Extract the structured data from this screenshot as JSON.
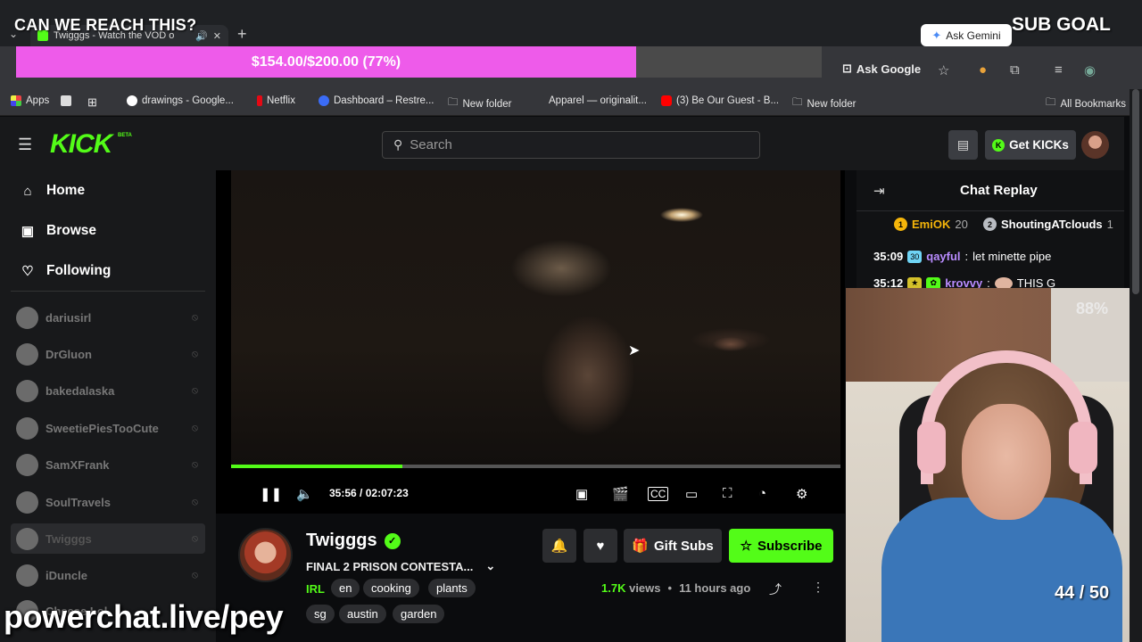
{
  "browser": {
    "tab_title": "Twigggs - Watch the VOD o",
    "new_tab": "+",
    "ask_gemini": "Ask Gemini",
    "ask_google": "Ask Google",
    "bookmarks": [
      {
        "label": "Apps",
        "color": "#e44"
      },
      {
        "label": "drawings - Google...",
        "color": "#fff"
      },
      {
        "label": "Netflix",
        "color": "#e50914"
      },
      {
        "label": "Dashboard – Restre...",
        "color": "#3b6cf6"
      },
      {
        "label": "New folder",
        "color": "#aaa"
      },
      {
        "label": "Apparel — originalit...",
        "color": "#35363a"
      },
      {
        "label": "(3) Be Our Guest - B...",
        "color": "#f00"
      },
      {
        "label": "New folder",
        "color": "#aaa"
      },
      {
        "label": "All Bookmarks",
        "color": "#aaa"
      }
    ]
  },
  "overlay": {
    "title": "CAN WE REACH THIS?",
    "goal_text": "$154.00/$200.00 (77%)",
    "goal_fraction": 0.77,
    "sub_goal_label": "SUB GOAL",
    "sub_count": "44 / 50",
    "webcam_pct": "88%",
    "powerchat": "powerchat.live/pey"
  },
  "kick": {
    "logo": "KICK",
    "logo_beta": "BETA",
    "search_placeholder": "Search",
    "get_kicks": "Get KICKs",
    "nav": [
      {
        "label": "Home",
        "icon": "home-icon"
      },
      {
        "label": "Browse",
        "icon": "browse-icon"
      },
      {
        "label": "Following",
        "icon": "heart-icon"
      }
    ],
    "channels": [
      "dariusirl",
      "DrGluon",
      "bakedalaska",
      "SweetiePiesTooCute",
      "SamXFrank",
      "SoulTravels",
      "Twigggs",
      "iDuncle",
      "Cheese Lol"
    ]
  },
  "player": {
    "time_current": "35:56",
    "time_total": "02:07:23",
    "progress_fraction": 0.281
  },
  "stream": {
    "channel": "Twigggs",
    "title": "FINAL 2 PRISON CONTESTA...",
    "category": "IRL",
    "tags": [
      "en",
      "cooking",
      "plants",
      "sg",
      "austin",
      "garden"
    ],
    "gift_subs": "Gift Subs",
    "subscribe": "Subscribe",
    "views_num": "1.7K",
    "views_label": "views",
    "ago": "11 hours ago"
  },
  "chat": {
    "title": "Chat Replay",
    "leaderboard": [
      {
        "rank": "1",
        "name": "EmiOK",
        "points": "20",
        "color": "#f5b50a"
      },
      {
        "rank": "2",
        "name": "ShoutingATclouds",
        "points": "1",
        "color": "#b9bcc2"
      }
    ],
    "messages": [
      {
        "time": "35:09",
        "badge": "30",
        "badge_color": "#6fd4f5",
        "user": "qayful",
        "user_color": "#b98cff",
        "text": "let minette pipe"
      },
      {
        "time": "35:12",
        "badge": "★",
        "badge_color": "#d4c12a",
        "user": "krovvy",
        "user_color": "#b98cff",
        "text": "THIS G"
      }
    ]
  }
}
